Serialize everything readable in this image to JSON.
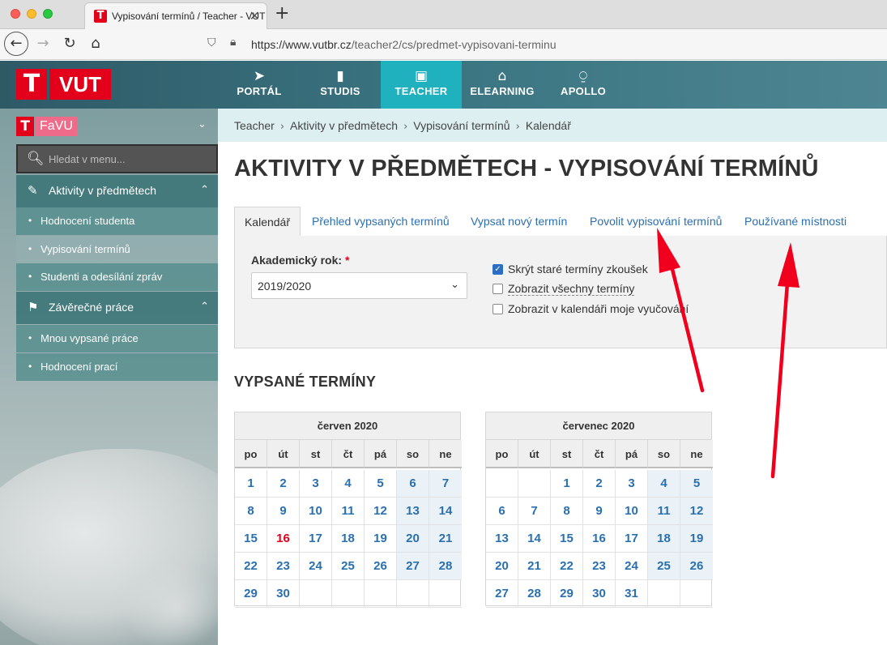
{
  "browser": {
    "tab_title": "Vypisování termínů / Teacher - VUT",
    "new_tab": "+",
    "url_main": "https://www.vutbr.cz",
    "url_path": "/teacher2/cs/predmet-vypisovani-terminu"
  },
  "header": {
    "logo_t": "T",
    "logo_text": "VUT",
    "nav": [
      {
        "label": "PORTÁL",
        "icon": "➤"
      },
      {
        "label": "STUDIS",
        "icon": "▮"
      },
      {
        "label": "TEACHER",
        "icon": "▣"
      },
      {
        "label": "ELEARNING",
        "icon": "⌂"
      },
      {
        "label": "APOLLO",
        "icon": "⍜"
      }
    ]
  },
  "sidebar": {
    "faculty_t": "T",
    "faculty": "FaVU",
    "search_placeholder": "Hledat v menu...",
    "sections": [
      {
        "label": "Aktivity v předmětech",
        "items": [
          "Hodnocení studenta",
          "Vypisování termínů",
          "Studenti a odesílání zpráv"
        ]
      },
      {
        "label": "Závěrečné práce",
        "items": [
          "Mnou vypsané práce",
          "Hodnocení prací"
        ]
      }
    ]
  },
  "breadcrumb": [
    "Teacher",
    "Aktivity v předmětech",
    "Vypisování termínů",
    "Kalendář"
  ],
  "page_title": "AKTIVITY V PŘEDMĚTECH - VYPISOVÁNÍ TERMÍNŮ",
  "tabs": [
    "Kalendář",
    "Přehled vypsaných termínů",
    "Vypsat nový termín",
    "Povolit vypisování termínů",
    "Používané místnosti"
  ],
  "filter": {
    "year_label": "Akademický rok:",
    "required_mark": "*",
    "year_value": "2019/2020",
    "checkboxes": [
      {
        "label": "Skrýt staré termíny zkoušek",
        "checked": true
      },
      {
        "label": "Zobrazit všechny termíny",
        "checked": false
      },
      {
        "label": "Zobrazit v kalendáři moje vyučování",
        "checked": false
      }
    ]
  },
  "section_title": "VYPSANÉ TERMÍNY",
  "calendar": {
    "weekdays": [
      "po",
      "út",
      "st",
      "čt",
      "pá",
      "so",
      "ne"
    ],
    "months": [
      {
        "title": "červen 2020",
        "first_weekday": 0,
        "days": 30,
        "today": 16
      },
      {
        "title": "červenec 2020",
        "first_weekday": 2,
        "days": 31,
        "today": null
      }
    ]
  },
  "colors": {
    "brand_red": "#e2001a",
    "accent_teal": "#1fb1bd",
    "link_blue": "#2a6fb0",
    "annotation_red": "#f0001c"
  }
}
